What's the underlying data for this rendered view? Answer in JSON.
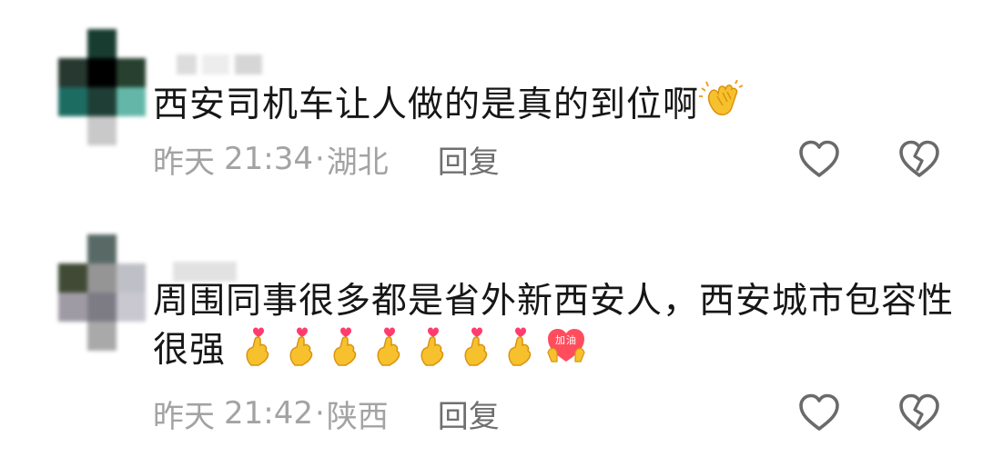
{
  "comments": [
    {
      "text": "西安司机车让人做的是真的到位啊",
      "emoji": [
        "clapping-hands-icon"
      ],
      "date": "昨天",
      "time": "21:34",
      "separator": "·",
      "location": "湖北",
      "reply_label": "回复",
      "like_icon": "heart-outline-icon",
      "dislike_icon": "broken-heart-outline-icon"
    },
    {
      "text": "周围同事很多都是省外新西安人，西安城市包容性很强",
      "emoji": [
        "finger-heart-icon",
        "finger-heart-icon",
        "finger-heart-icon",
        "finger-heart-icon",
        "finger-heart-icon",
        "finger-heart-icon",
        "finger-heart-icon",
        "jiayou-heart-icon"
      ],
      "emoji_text": "加油",
      "date": "昨天",
      "time": "21:42",
      "separator": "·",
      "location": "陕西",
      "reply_label": "回复",
      "like_icon": "heart-outline-icon",
      "dislike_icon": "broken-heart-outline-icon"
    }
  ],
  "colors": {
    "text": "#161616",
    "meta": "#a3a3a3",
    "reply": "#6f6f6f",
    "icon_stroke": "#6a6a6a"
  }
}
